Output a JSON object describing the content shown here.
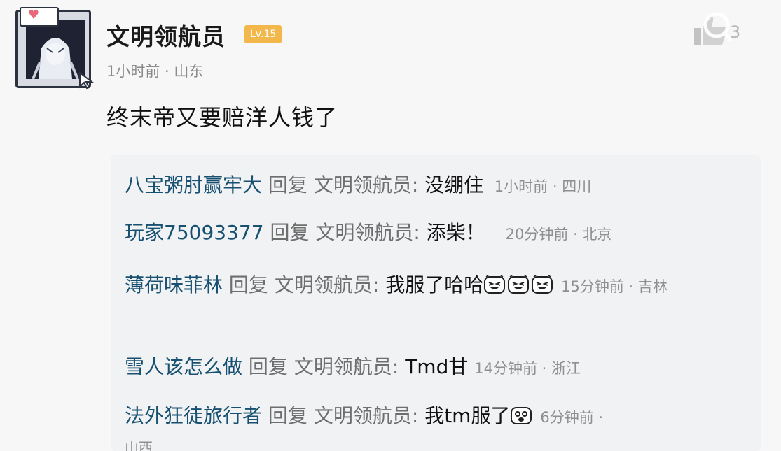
{
  "post": {
    "username": "文明领航员",
    "level": "Lv.15",
    "time": "1小时前",
    "location": "山东",
    "content": "终末帝又要赔洋人钱了"
  },
  "like_count": "3",
  "replies": [
    {
      "name": "八宝粥肘赢牢大",
      "action": "回复",
      "target": "文明领航员:",
      "text": "没绷住",
      "time": "1小时前",
      "location": "四川"
    },
    {
      "name": "玩家75093377",
      "action": "回复",
      "target": "文明领航员:",
      "text": "添柴！",
      "time": "20分钟前",
      "location": "北京"
    },
    {
      "name": "薄荷味菲林",
      "action": "回复",
      "target": "文明领航员:",
      "text": "我服了哈哈",
      "time": "15分钟前",
      "location": "吉林"
    },
    {
      "name": "雪人该怎么做",
      "action": "回复",
      "target": "文明领航员:",
      "text": "Tmd甘",
      "time": "14分钟前",
      "location": "浙江"
    },
    {
      "name": "法外狂徒旅行者",
      "action": "回复",
      "target": "文明领航员:",
      "text": "我tm服了",
      "time": "6分钟前",
      "location": "山西"
    }
  ],
  "icons": {
    "avatar": "anime-avatar-tv-frame",
    "heart": "heart-icon",
    "like": "thumb-up-icon",
    "emoji": "laughing-crying-emoji",
    "speechless": "speechless-emoji"
  },
  "colors": {
    "username_reply": "#175070",
    "level_badge": "#f2b84b",
    "meta": "#8f8f8f"
  }
}
